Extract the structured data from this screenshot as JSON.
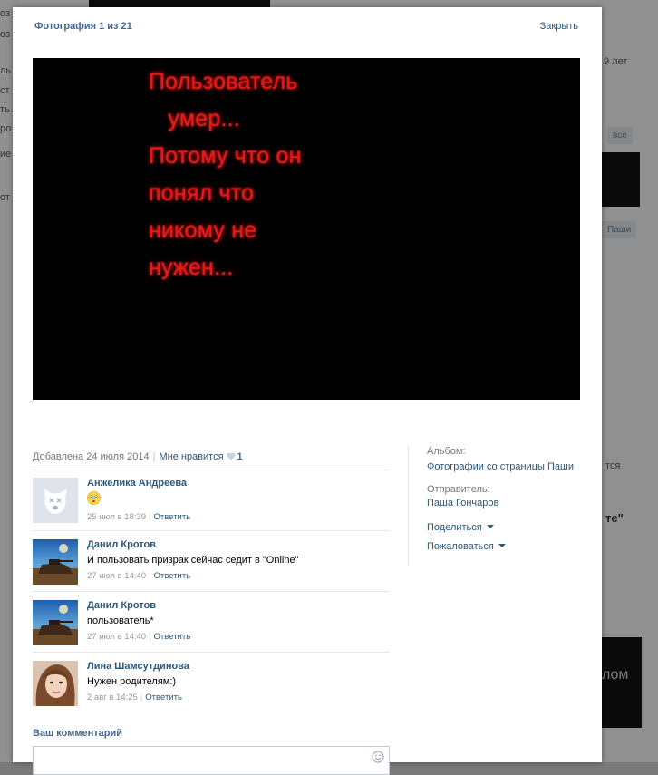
{
  "background": {
    "fragments_left": [
      "оз",
      "оз",
      "ль",
      "ст",
      "ть",
      "ро",
      "ие",
      "от"
    ],
    "right_age": "9 лет",
    "right_btn_all": "все",
    "right_btn_pasha": "Паши",
    "right_like": "тся",
    "right_quote": "те\"",
    "right_dark_text": "лом"
  },
  "modal": {
    "counter": "Фотография 1 из 21",
    "close": "Закрыть",
    "photo_text": "Пользователь\n   умер...\nПотому что он\nпонял что\nникому не\nнужен...",
    "added": "Добавлена 24 июля 2014",
    "like_label": "Мне нравится",
    "like_count": "1",
    "comments": [
      {
        "name": "Анжелика Андреева",
        "text": "",
        "emoji": "flushed-face",
        "date": "25 июл в 18:39",
        "reply": "Ответить"
      },
      {
        "name": "Данил Кротов",
        "text": "И пользовать призрак сейчас седит в \"Online\"",
        "date": "27 июл в 14:40",
        "reply": "Ответить"
      },
      {
        "name": "Данил Кротов",
        "text": "пользователь*",
        "date": "27 июл в 14:40",
        "reply": "Ответить"
      },
      {
        "name": "Лина Шамсутдинова",
        "text": "Нужен родителям:)",
        "date": "2 авг в 14:25",
        "reply": "Ответить"
      }
    ],
    "your_comment_label": "Ваш комментарий",
    "comment_input_value": "",
    "sidebar": {
      "album_label": "Альбом:",
      "album_link": "Фотографии со страницы Паши",
      "sender_label": "Отправитель:",
      "sender_link": "Паша Гончаров",
      "share": "Поделиться",
      "report": "Пожаловаться"
    }
  },
  "colors": {
    "link": "#2b587a",
    "header": "#45688e",
    "photo_text": "#e11a1a"
  }
}
